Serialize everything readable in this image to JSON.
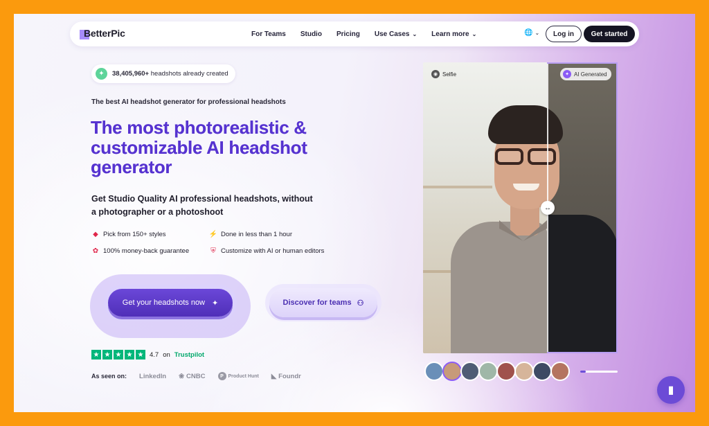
{
  "nav": {
    "logo": "BetterPic",
    "links": [
      {
        "label": "For Teams",
        "dropdown": false
      },
      {
        "label": "Studio",
        "dropdown": false
      },
      {
        "label": "Pricing",
        "dropdown": false
      },
      {
        "label": "Use Cases",
        "dropdown": true
      },
      {
        "label": "Learn more",
        "dropdown": true
      }
    ],
    "login": "Log in",
    "get_started": "Get started"
  },
  "badge": {
    "count": "38,405,960+",
    "text": " headshots already created"
  },
  "eyebrow": "The best AI headshot generator for professional headshots",
  "headline": {
    "accent": "The most photorealistic &",
    "line2": "customizable AI headshot",
    "line3": "generator"
  },
  "subhead": "Get Studio Quality AI professional headshots, without a photographer or a photoshoot",
  "features": [
    {
      "icon": "tag-icon",
      "label": "Pick from 150+ styles"
    },
    {
      "icon": "lightning-icon",
      "label": "Done in less than 1 hour"
    },
    {
      "icon": "award-icon",
      "label": "100% money-back guarantee"
    },
    {
      "icon": "shield-icon",
      "label": "Customize with AI or human editors"
    }
  ],
  "cta": {
    "primary": "Get your headshots now",
    "secondary": "Discover for teams"
  },
  "rating": {
    "score": "4.7",
    "on": "on",
    "platform": "Trustpilot",
    "stars": 5
  },
  "seen": {
    "label": "As seen on:",
    "outlets": [
      "LinkedIn",
      "CNBC",
      "Product Hunt",
      "Foundr"
    ]
  },
  "photo": {
    "left_tag": "Selfie",
    "right_tag": "AI Generated"
  },
  "thumbnails": {
    "count": 8,
    "active_index": 1,
    "progress": 0.15
  },
  "colors": {
    "accent": "#5633d0",
    "trustpilot": "#00b67a",
    "frame": "#fb9a0d"
  }
}
